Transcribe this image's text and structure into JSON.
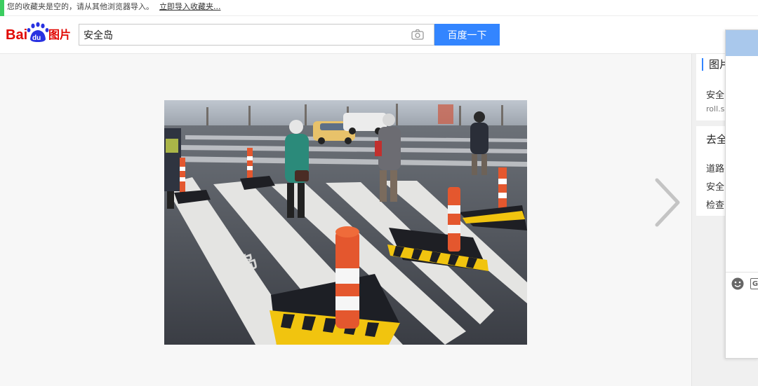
{
  "bookmarks": {
    "message": "您的收藏夹是空的，请从其他浏览器导入。",
    "import_link": "立即导入收藏夹..."
  },
  "logo": {
    "text_bai": "Bai",
    "text_du": "du",
    "text_image": "图片"
  },
  "search": {
    "query": "安全岛",
    "button_label": "百度一下"
  },
  "right_panel": {
    "card1": {
      "title": "图片",
      "line1": "安全",
      "line2": "roll.s"
    },
    "card2": {
      "title": "去全",
      "items": [
        "道路",
        "安全",
        "检查"
      ]
    }
  },
  "colors": {
    "accent": "#3385ff",
    "green": "#3ccd60",
    "logo_red": "#e10601",
    "logo_blue": "#2932e1"
  }
}
